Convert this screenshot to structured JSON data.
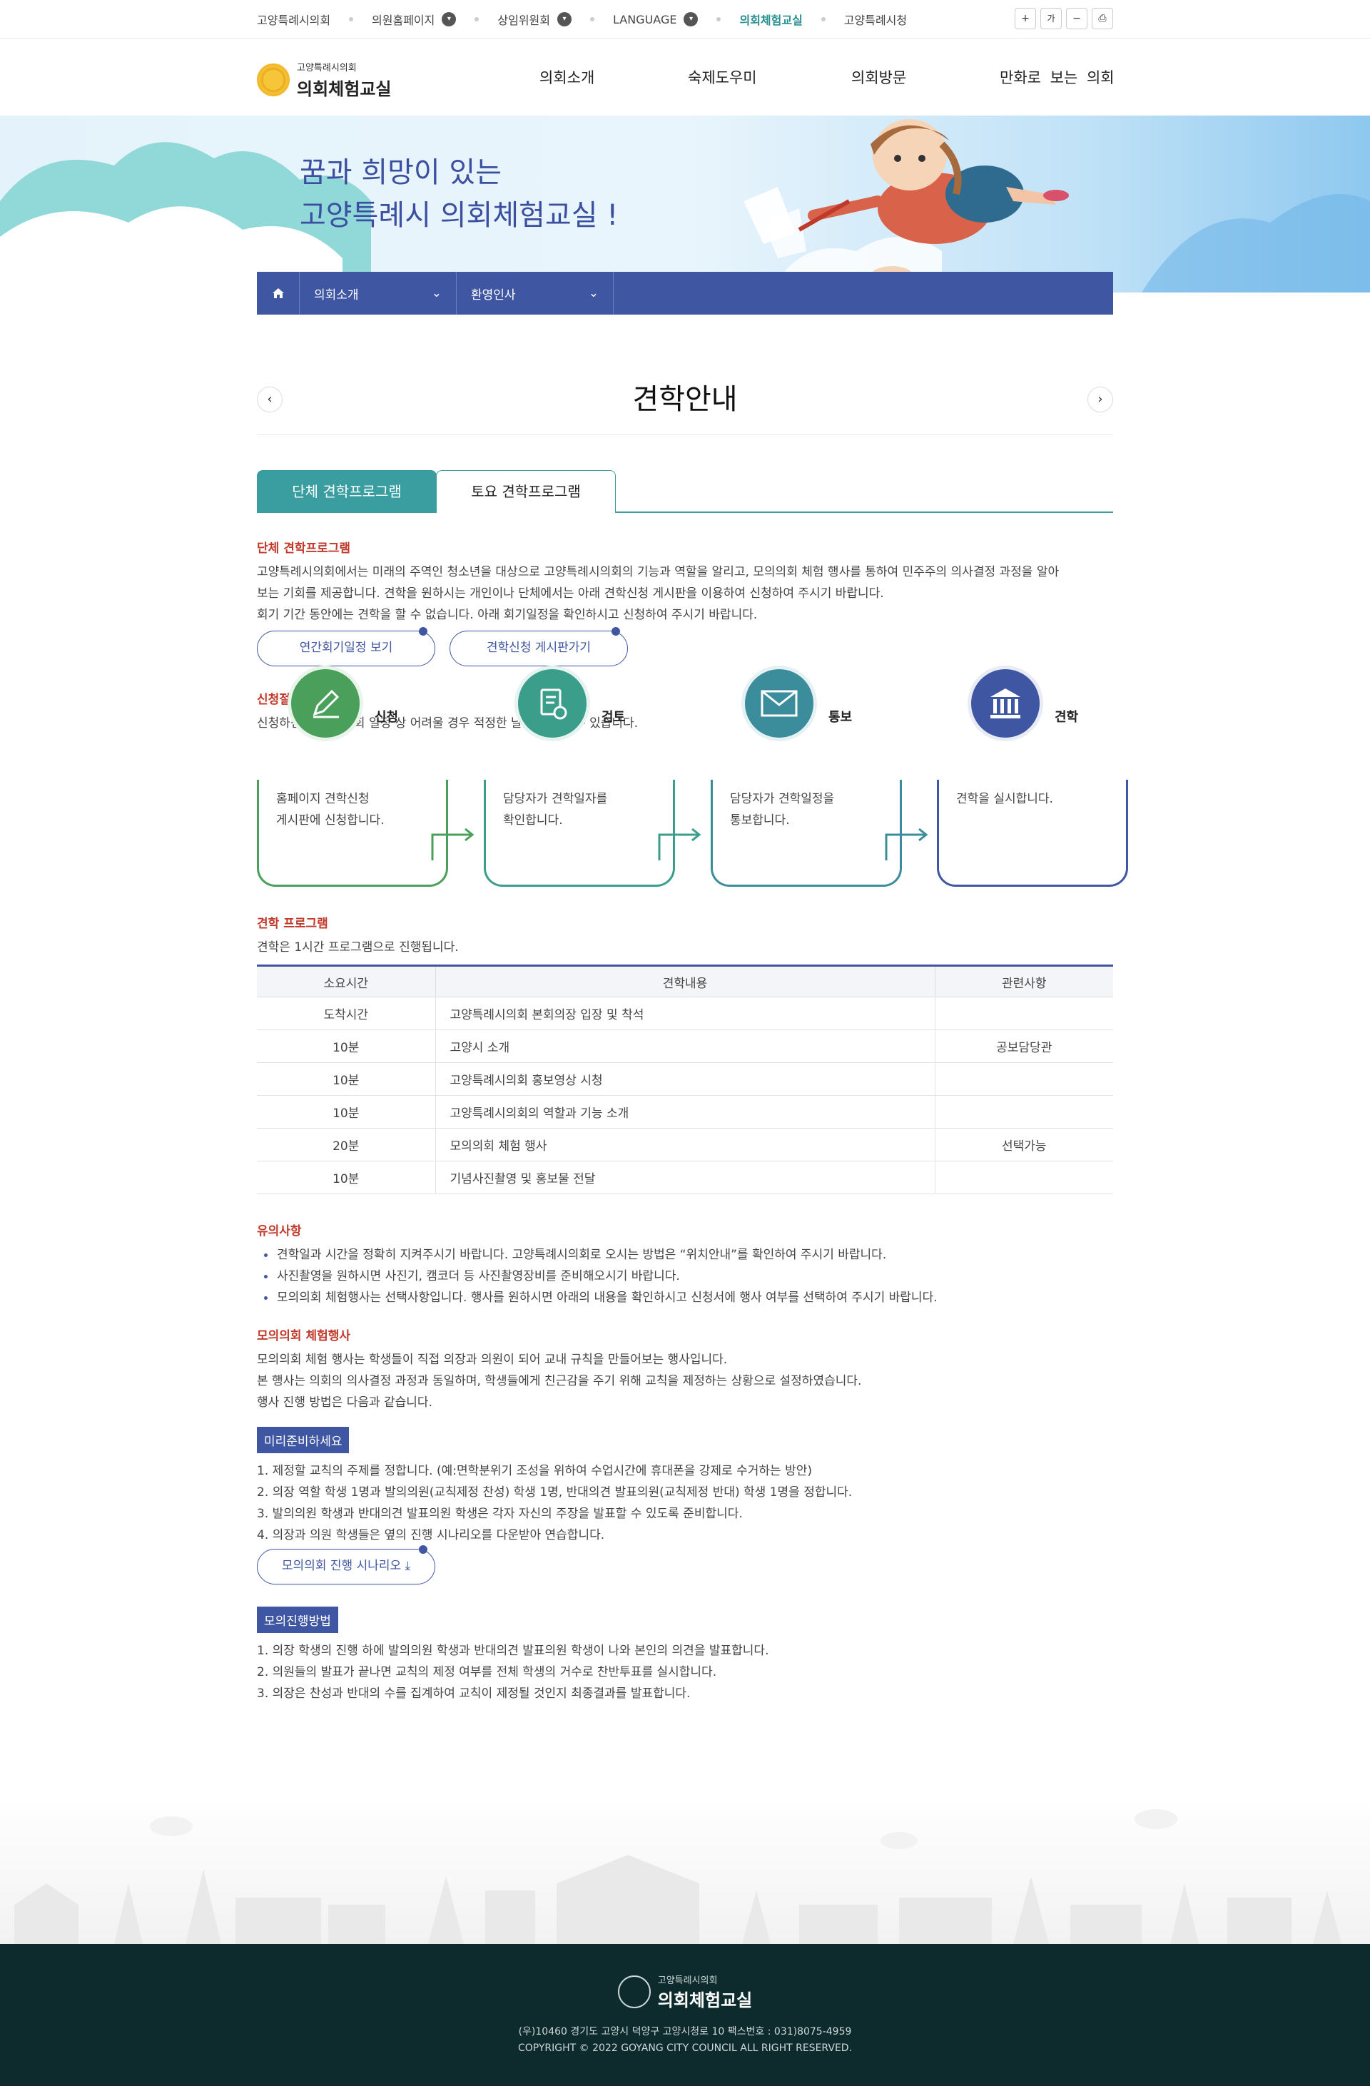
{
  "util_bar": {
    "links": [
      {
        "label": "고양특례시의회",
        "has_dropdown": false,
        "active": false
      },
      {
        "label": "의원홈페이지",
        "has_dropdown": true,
        "active": false
      },
      {
        "label": "상임위원회",
        "has_dropdown": true,
        "active": false
      },
      {
        "label": "LANGUAGE",
        "has_dropdown": true,
        "active": false
      },
      {
        "label": "의회체험교실",
        "has_dropdown": false,
        "active": true
      },
      {
        "label": "고양특례시청",
        "has_dropdown": false,
        "active": false
      }
    ],
    "dropdown_icon": "▾",
    "tools": {
      "zoom_in": "+",
      "font": "가",
      "zoom_out": "−",
      "print": "⎙"
    }
  },
  "header": {
    "logo_small": "고양특례시의회",
    "logo_large": "의회체험교실",
    "nav": [
      "의회소개",
      "숙제도우미",
      "의회방문",
      "만화로 보는 의회"
    ]
  },
  "banner": {
    "line1": "꿈과 희망이 있는",
    "line2": "고양특례시 의회체험교실 !"
  },
  "location": {
    "crumb1": "의회소개",
    "crumb2": "환영인사",
    "chevron": "⌄"
  },
  "page": {
    "title": "견학안내",
    "prev": "‹",
    "next": "›"
  },
  "tabs": [
    "단체 견학프로그램",
    "토요 견학프로그램"
  ],
  "group_program": {
    "title": "단체 견학프로그램",
    "lines": [
      "고양특례시의회에서는 미래의 주역인 청소년을 대상으로 고양특례시의회의 기능과 역할을 알리고, 모의의회 체험 행사를 통하여 민주주의 의사결정 과정을 알아",
      "보는 기회를 제공합니다. 견학을 원하시는 개인이나 단체에서는 아래 견학신청 게시판을 이용하여 신청하여 주시기 바랍니다.",
      "회기 기간 동안에는 견학을 할 수 없습니다. 아래 회기일정을 확인하시고 신청하여 주시기 바랍니다."
    ],
    "btn_schedule": "연간회기일정 보기",
    "btn_board": "견학신청 게시판가기"
  },
  "procedure": {
    "title": "신청절차",
    "desc": "신청하신 일정이 의회 일정 상 어려울 경우 적정한 날로 조정될 수 있습니다.",
    "steps": [
      {
        "label": "신청",
        "line1": "홈페이지 견학신청",
        "line2": "게시판에 신청합니다.",
        "color": "#4aa05a"
      },
      {
        "label": "검토",
        "line1": "담당자가 견학일자를",
        "line2": "확인합니다.",
        "color": "#3a9e8a"
      },
      {
        "label": "통보",
        "line1": "담당자가 견학일정을",
        "line2": "통보합니다.",
        "color": "#3b8d9c"
      },
      {
        "label": "견학",
        "line1": "견학을 실시합니다.",
        "line2": "",
        "color": "#3f57a3"
      }
    ],
    "arrow": "→"
  },
  "program": {
    "title": "견학 프로그램",
    "desc": "견학은 1시간 프로그램으로 진행됩니다.",
    "headers": [
      "소요시간",
      "견학내용",
      "관련사항"
    ],
    "rows": [
      [
        "도착시간",
        "고양특례시의회 본회의장 입장 및 착석",
        ""
      ],
      [
        "10분",
        "고양시 소개",
        "공보담당관"
      ],
      [
        "10분",
        "고양특례시의회 홍보영상 시청",
        ""
      ],
      [
        "10분",
        "고양특례시의회의 역할과 기능 소개",
        ""
      ],
      [
        "20분",
        "모의의회 체험 행사",
        "선택가능"
      ],
      [
        "10분",
        "기념사진촬영 및 홍보물 전달",
        ""
      ]
    ]
  },
  "notes": {
    "title": "유의사항",
    "items": [
      "견학일과 시간을 정확히 지켜주시기 바랍니다. 고양특례시의회로 오시는 방법은 “위치안내”를 확인하여 주시기 바랍니다.",
      "사진촬영을 원하시면 사진기, 캠코더 등 사진촬영장비를 준비해오시기 바랍니다.",
      "모의의회 체험행사는 선택사항입니다. 행사를 원하시면 아래의 내용을 확인하시고 신청서에 행사 여부를 선택하여 주시기 바랍니다."
    ]
  },
  "mock": {
    "title": "모의의회 체험행사",
    "lines": [
      "모의의회 체험 행사는 학생들이 직접 의장과 의원이 되어 교내 규칙을 만들어보는 행사입니다.",
      "본 행사는 의회의 의사결정 과정과 동일하며, 학생들에게 친근감을 주기 위해 교칙을 제정하는 상황으로 설정하였습니다.",
      "행사 진행 방법은 다음과 같습니다."
    ],
    "prep_badge": "미리준비하세요",
    "prep_items": [
      "1. 제정할 교칙의 주제를 정합니다. (예:면학분위기 조성을 위하여 수업시간에 휴대폰을 강제로 수거하는 방안)",
      "2. 의장 역할 학생 1명과 발의의원(교칙제정 찬성) 학생 1명, 반대의견 발표의원(교칙제정 반대) 학생 1명을 정합니다.",
      "3. 발의의원 학생과 반대의견 발표의원 학생은 각자 자신의 주장을 발표할 수 있도록 준비합니다.",
      "4. 의장과 의원 학생들은 옆의 진행 시나리오를 다운받아 연습합니다."
    ],
    "scenario_btn": "모의의회 진행 시나리오",
    "download_icon": "⤓",
    "method_badge": "모의진행방법",
    "method_items": [
      "1. 의장 학생의 진행 하에 발의의원 학생과 반대의견 발표의원 학생이 나와 본인의 의견을 발표합니다.",
      "2. 의원들의 발표가 끝나면 교칙의 제정 여부를 전체 학생의 거수로 찬반투표를 실시합니다.",
      "3. 의장은 찬성과 반대의 수를 집계하여 교칙이 제정될 것인지 최종결과를 발표합니다."
    ]
  },
  "footer": {
    "logo_small": "고양특례시의회",
    "logo_large": "의회체험교실",
    "address": "(우)10460 경기도 고양시 덕양구 고양시청로 10 팩스번호 : 031)8075-4959",
    "copyright": "COPYRIGHT © 2022 GOYANG CITY COUNCIL ALL RIGHT RESERVED."
  }
}
